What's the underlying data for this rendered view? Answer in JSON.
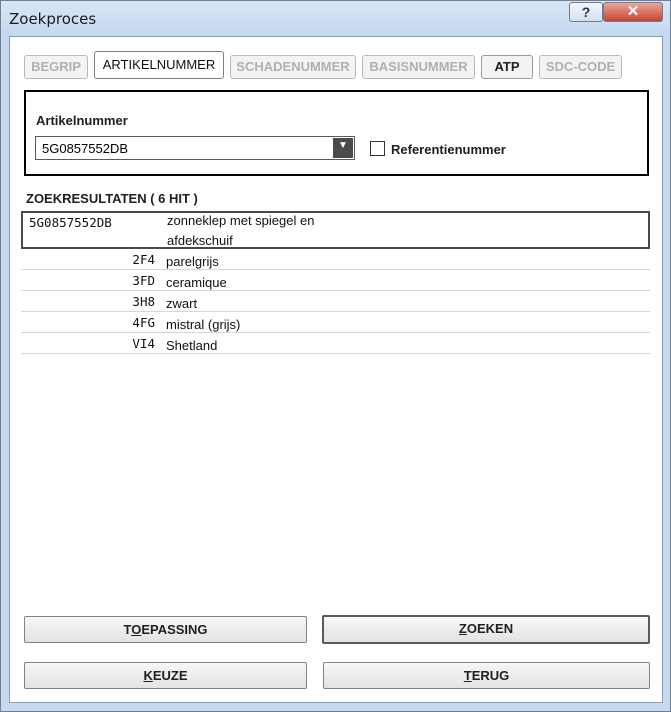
{
  "window": {
    "title": "Zoekproces",
    "help_symbol": "?",
    "close_symbol": "✕"
  },
  "tabs": [
    {
      "label": "BEGRIP",
      "state": "disabled"
    },
    {
      "label": "ARTIKELNUMMER",
      "state": "active"
    },
    {
      "label": "SCHADENUMMER",
      "state": "disabled"
    },
    {
      "label": "BASISNUMMER",
      "state": "disabled"
    },
    {
      "label": "ATP",
      "state": "enabled"
    },
    {
      "label": "SDC-CODE",
      "state": "disabled"
    }
  ],
  "search": {
    "label": "Artikelnummer",
    "value": "5G0857552DB",
    "dropdown_icon": "▼",
    "reference_label": "Referentienummer",
    "reference_checked": false
  },
  "results": {
    "header": "ZOEKRESULTATEN  ( 6 HIT )",
    "main": {
      "code": "5G0857552DB",
      "line1": "zonneklep met spiegel en",
      "line2": "afdekschuif"
    },
    "rows": [
      {
        "code": "2F4",
        "desc": "parelgrijs"
      },
      {
        "code": "3FD",
        "desc": "ceramique"
      },
      {
        "code": "3H8",
        "desc": "zwart"
      },
      {
        "code": "4FG",
        "desc": "mistral (grijs)"
      },
      {
        "code": "VI4",
        "desc": "Shetland"
      }
    ]
  },
  "buttons": {
    "toepassing": {
      "pre": "T",
      "key": "O",
      "post": "EPASSING"
    },
    "zoeken": {
      "pre": "",
      "key": "Z",
      "post": "OEKEN"
    },
    "keuze": {
      "pre": "",
      "key": "K",
      "post": "EUZE"
    },
    "terug": {
      "pre": "",
      "key": "T",
      "post": "ERUG"
    }
  }
}
